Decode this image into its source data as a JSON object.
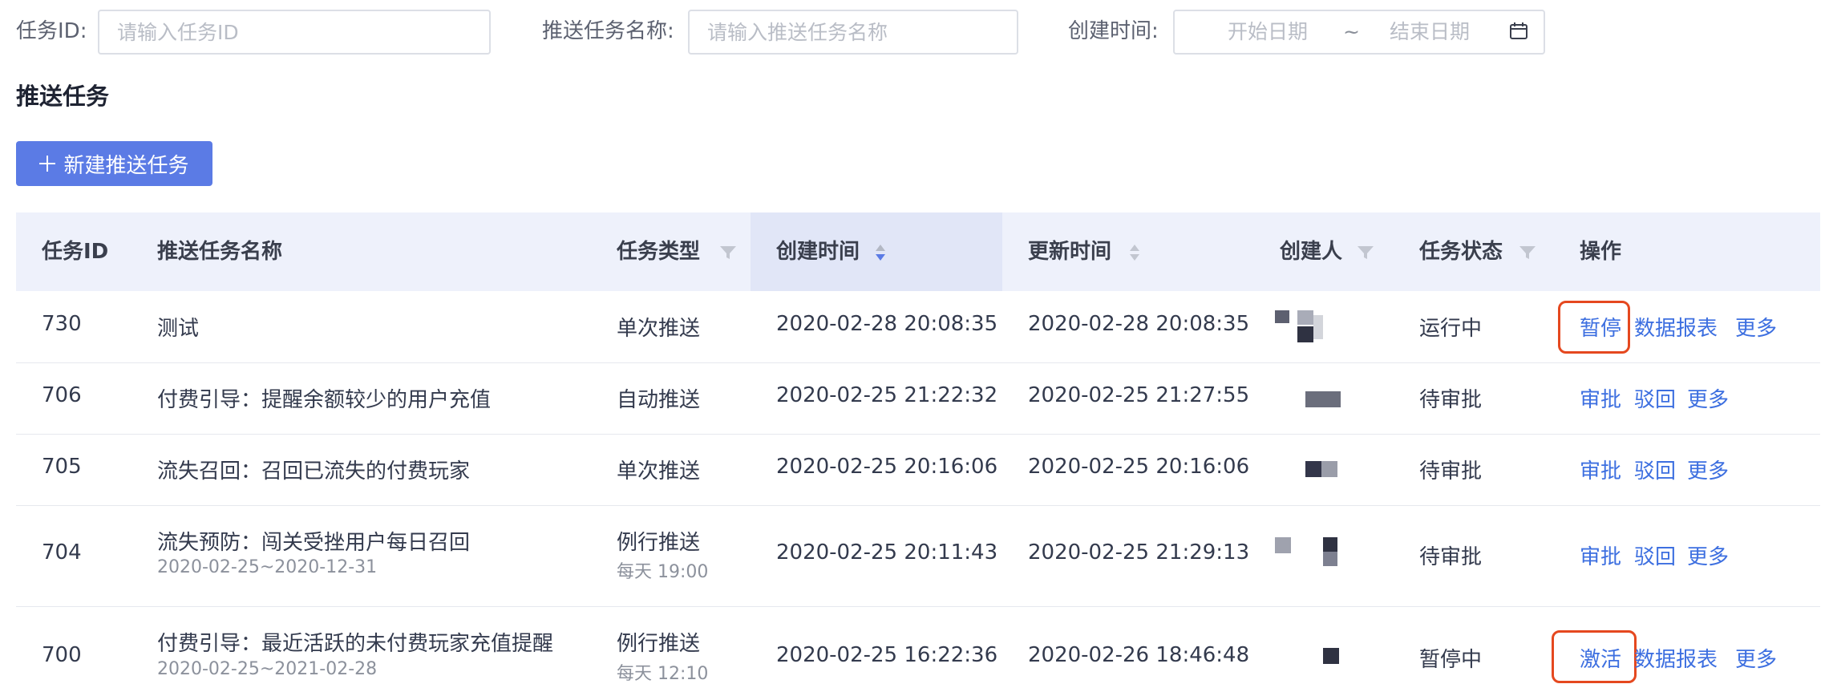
{
  "filters": {
    "task_id_label": "任务ID:",
    "task_id_placeholder": "请输入任务ID",
    "task_name_label": "推送任务名称:",
    "task_name_placeholder": "请输入推送任务名称",
    "created_label": "创建时间:",
    "start_placeholder": "开始日期",
    "separator": "~",
    "end_placeholder": "结束日期"
  },
  "section_title": "推送任务",
  "new_button_label": "新建推送任务",
  "table": {
    "headers": [
      "任务ID",
      "推送任务名称",
      "任务类型",
      "创建时间",
      "更新时间",
      "创建人",
      "任务状态",
      "操作"
    ],
    "rows": [
      {
        "id": "730",
        "name": "测试",
        "name_sub": "",
        "type": "单次推送",
        "type_sub": "",
        "created": "2020-02-28 20:08:35",
        "updated": "2020-02-28 20:08:35",
        "status": "运行中",
        "actions": [
          "暂停",
          "数据报表",
          "更多"
        ]
      },
      {
        "id": "706",
        "name": "付费引导：提醒余额较少的用户充值",
        "name_sub": "",
        "type": "自动推送",
        "type_sub": "",
        "created": "2020-02-25 21:22:32",
        "updated": "2020-02-25 21:27:55",
        "status": "待审批",
        "actions": [
          "审批",
          "驳回",
          "更多"
        ]
      },
      {
        "id": "705",
        "name": "流失召回：召回已流失的付费玩家",
        "name_sub": "",
        "type": "单次推送",
        "type_sub": "",
        "created": "2020-02-25 20:16:06",
        "updated": "2020-02-25 20:16:06",
        "status": "待审批",
        "actions": [
          "审批",
          "驳回",
          "更多"
        ]
      },
      {
        "id": "704",
        "name": "流失预防：闯关受挫用户每日召回",
        "name_sub": "2020-02-25~2020-12-31",
        "type": "例行推送",
        "type_sub": "每天 19:00",
        "created": "2020-02-25 20:11:43",
        "updated": "2020-02-25 21:29:13",
        "status": "待审批",
        "actions": [
          "审批",
          "驳回",
          "更多"
        ]
      },
      {
        "id": "700",
        "name": "付费引导：最近活跃的未付费玩家充值提醒",
        "name_sub": "2020-02-25~2021-02-28",
        "type": "例行推送",
        "type_sub": "每天 12:10",
        "created": "2020-02-25 16:22:36",
        "updated": "2020-02-26 18:46:48",
        "status": "暂停中",
        "actions": [
          "激活",
          "数据报表",
          "更多"
        ]
      }
    ]
  },
  "colors": {
    "primary": "#5b7be5",
    "link": "#3d6fe0",
    "highlight": "#e5481f",
    "header_bg": "#eef1fb"
  }
}
